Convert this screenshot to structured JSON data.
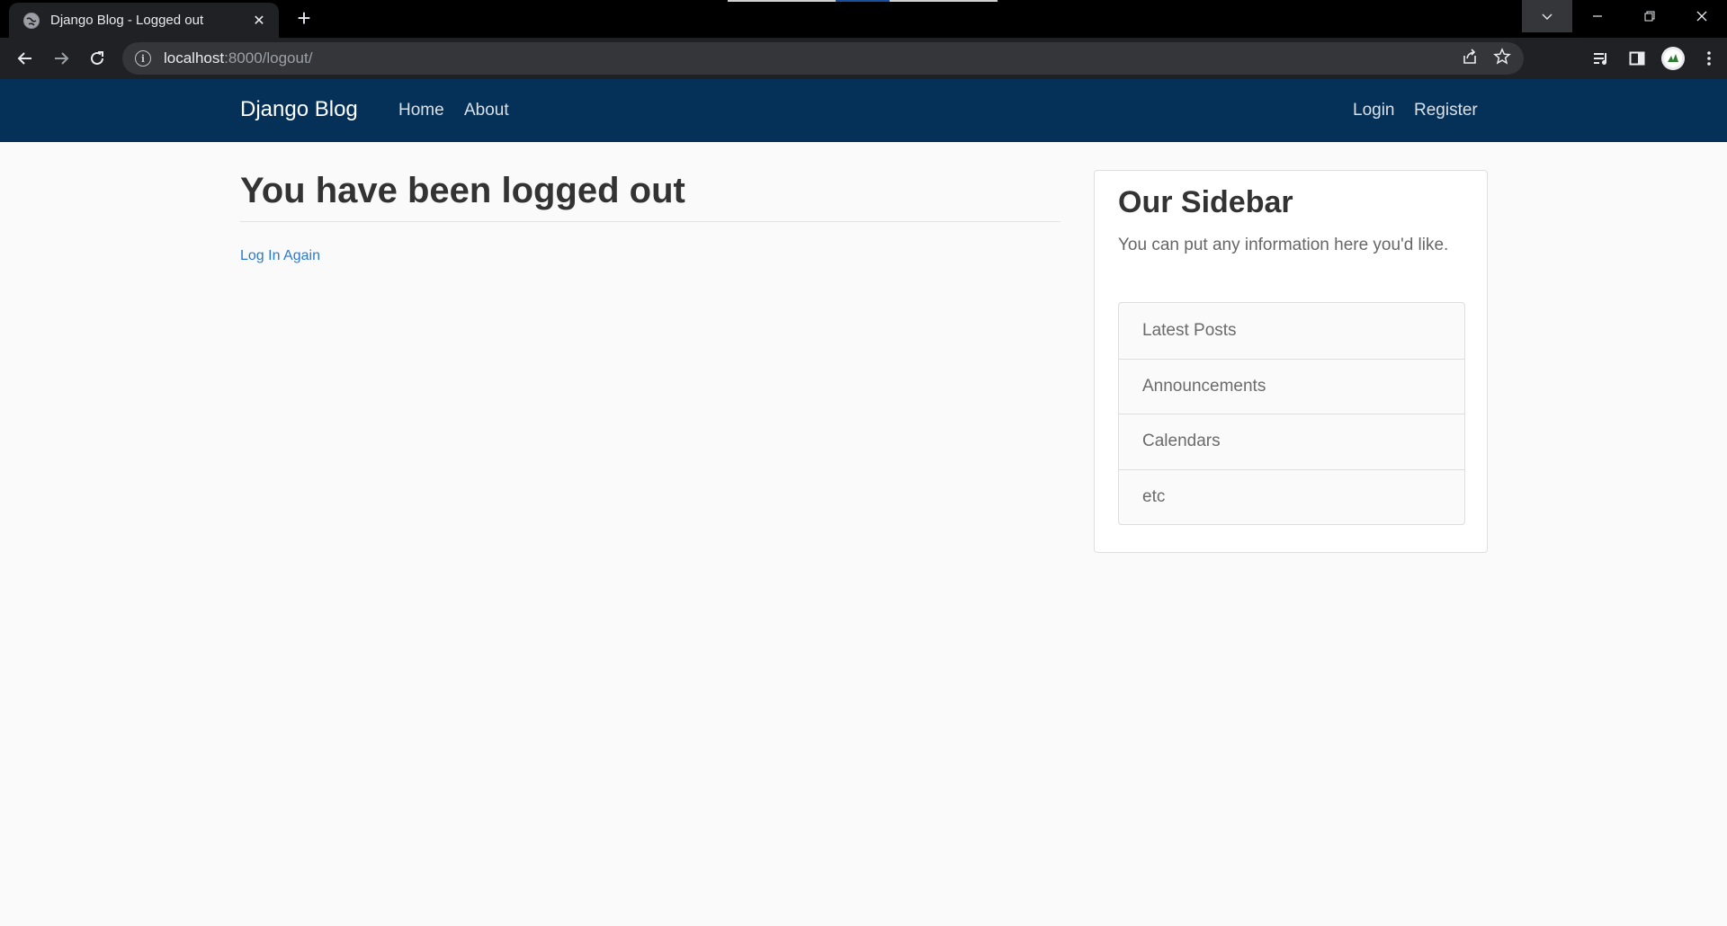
{
  "browser": {
    "tab_title": "Django Blog - Logged out",
    "url_host": "localhost",
    "url_path": ":8000/logout/"
  },
  "navbar": {
    "brand": "Django Blog",
    "left_links": [
      "Home",
      "About"
    ],
    "right_links": [
      "Login",
      "Register"
    ],
    "background": "#053159"
  },
  "main": {
    "title": "You have been logged out",
    "link_label": "Log In Again",
    "link_color": "#2b7ad0"
  },
  "sidebar": {
    "title": "Our Sidebar",
    "description": "You can put any information here you'd like.",
    "items": [
      "Latest Posts",
      "Announcements",
      "Calendars",
      "etc"
    ]
  }
}
